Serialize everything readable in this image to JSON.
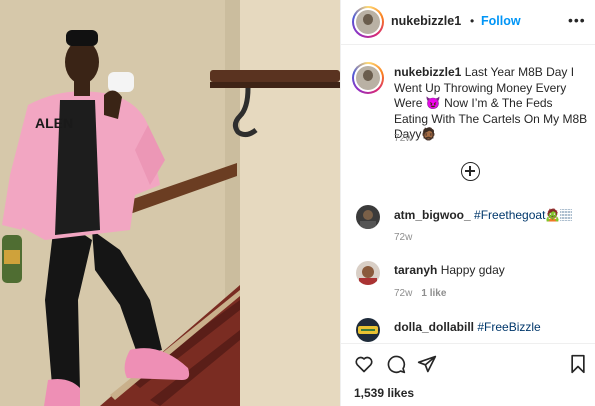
{
  "post": {
    "username": "nukebizzle1",
    "follow_label": "Follow",
    "separator": "•",
    "more_label": "•••",
    "caption_text": "Last Year M8B Day I Went Up Throwing Money Every Were 😈 Now I’m & The Feds Eating With The Cartels On My M8B Dayy🧔🏾",
    "caption_time": "72w",
    "likes": "1,539 likes"
  },
  "comments": [
    {
      "username": "atm_bigwoo_",
      "text": "#Freethegoat🧟🏽",
      "time": "72w",
      "likes": ""
    },
    {
      "username": "taranyh",
      "text": "Happy gday",
      "time": "72w",
      "likes": "1 like"
    },
    {
      "username": "dolla_dollabill",
      "text": "#FreeBizzle",
      "time": "",
      "likes": ""
    }
  ],
  "icons": {
    "more": "more-options-icon",
    "load_more": "plus-circle-icon",
    "like": "heart-icon",
    "comment": "comment-icon",
    "share": "paper-plane-icon",
    "save": "bookmark-icon"
  },
  "colors": {
    "follow": "#0095f6",
    "text": "#262626",
    "muted": "#8e8e8e",
    "hashtag": "#00376b"
  }
}
